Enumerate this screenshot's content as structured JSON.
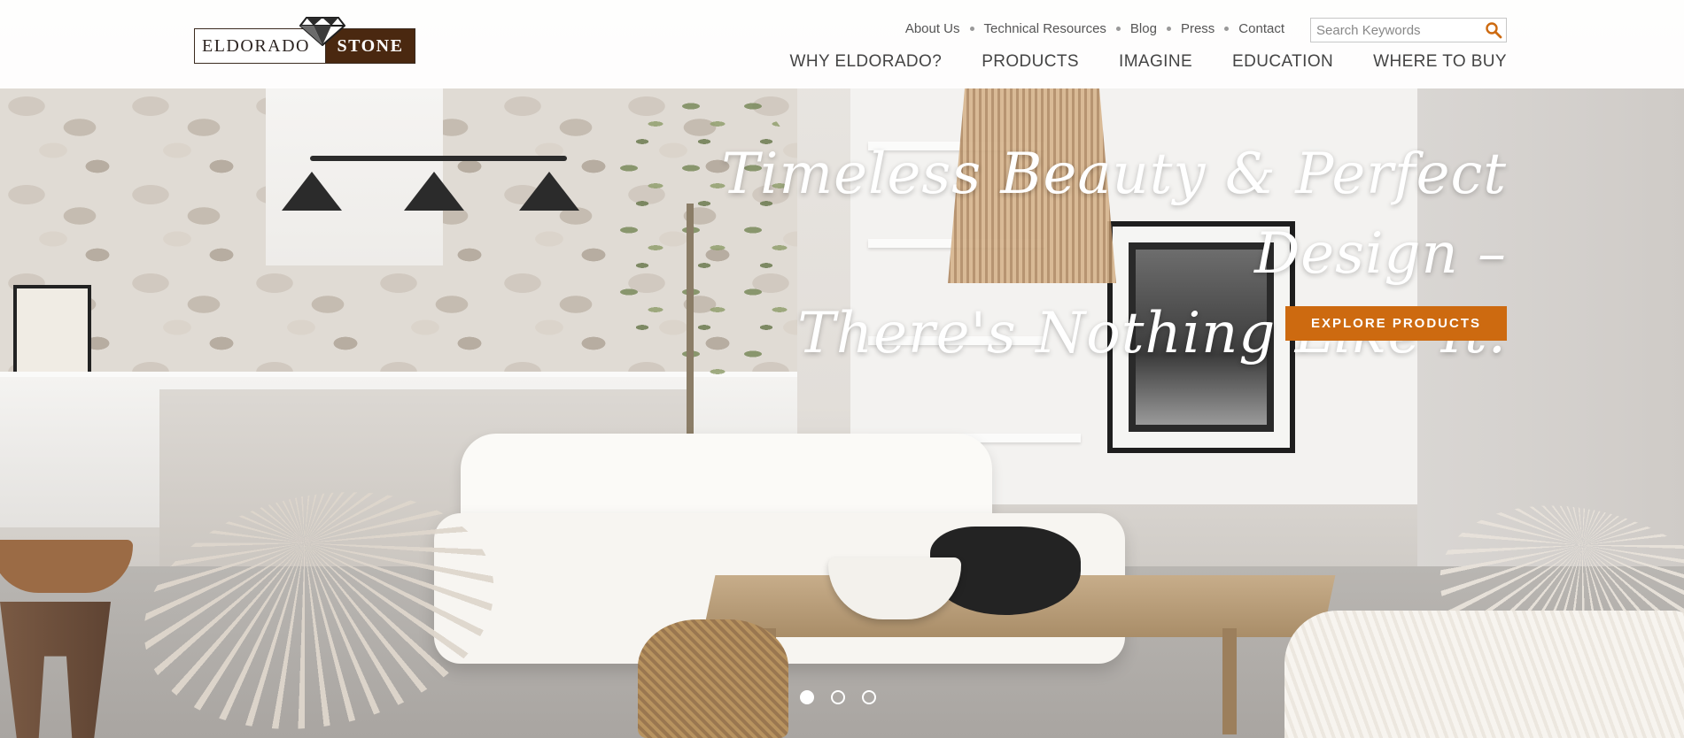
{
  "brand": {
    "logo_left": "ELDORADO",
    "logo_right": "STONE",
    "logo_icon": "diamond-icon"
  },
  "utility_nav": [
    {
      "label": "About Us"
    },
    {
      "label": "Technical Resources"
    },
    {
      "label": "Blog"
    },
    {
      "label": "Press"
    },
    {
      "label": "Contact"
    }
  ],
  "search": {
    "placeholder": "Search Keywords",
    "value": "",
    "icon": "search-icon"
  },
  "main_nav": [
    {
      "label": "WHY ELDORADO?"
    },
    {
      "label": "PRODUCTS"
    },
    {
      "label": "IMAGINE"
    },
    {
      "label": "EDUCATION"
    },
    {
      "label": "WHERE TO BUY"
    }
  ],
  "hero": {
    "headline_line1": "Timeless Beauty & Perfect Design –",
    "headline_line2": "There's Nothing Like It.",
    "cta_label": "EXPLORE PRODUCTS",
    "slides_total": 3,
    "active_slide": 1
  },
  "colors": {
    "accent": "#cd6a10",
    "logo_brown": "#4a2810",
    "nav_text": "#444444"
  }
}
